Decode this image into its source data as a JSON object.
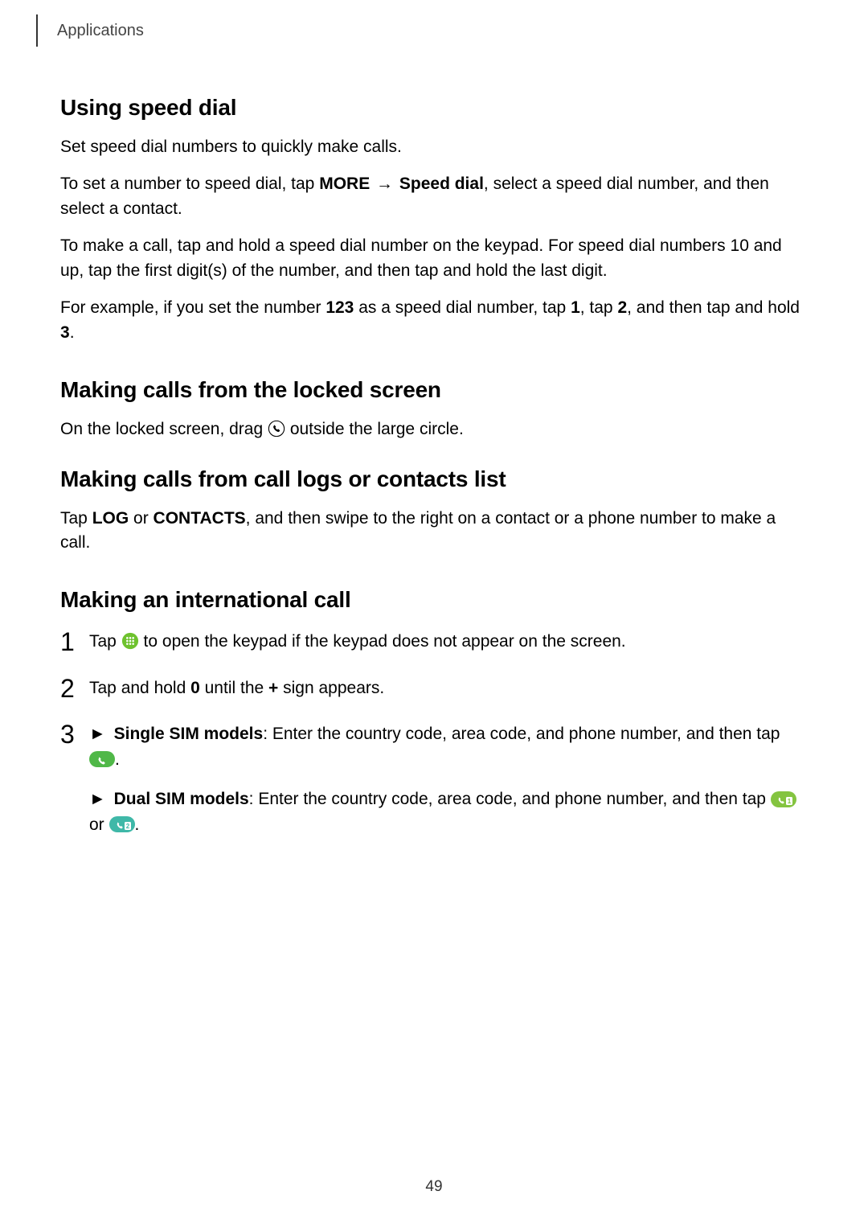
{
  "header": {
    "breadcrumb": "Applications"
  },
  "sections": {
    "speed_dial": {
      "title": "Using speed dial",
      "p1": "Set speed dial numbers to quickly make calls.",
      "p2_a": "To set a number to speed dial, tap ",
      "p2_more": "MORE",
      "p2_arrow": " → ",
      "p2_speed": "Speed dial",
      "p2_b": ", select a speed dial number, and then select a contact.",
      "p3": "To make a call, tap and hold a speed dial number on the keypad. For speed dial numbers 10 and up, tap the first digit(s) of the number, and then tap and hold the last digit.",
      "p4_a": "For example, if you set the number ",
      "p4_123": "123",
      "p4_b": " as a speed dial number, tap ",
      "p4_1": "1",
      "p4_c": ", tap ",
      "p4_2": "2",
      "p4_d": ", and then tap and hold ",
      "p4_3": "3",
      "p4_e": "."
    },
    "locked": {
      "title": "Making calls from the locked screen",
      "p1_a": "On the locked screen, drag ",
      "p1_b": " outside the large circle."
    },
    "logs": {
      "title": "Making calls from call logs or contacts list",
      "p1_a": "Tap ",
      "p1_log": "LOG",
      "p1_b": " or ",
      "p1_contacts": "CONTACTS",
      "p1_c": ", and then swipe to the right on a contact or a phone number to make a call."
    },
    "intl": {
      "title": "Making an international call",
      "step1_a": "Tap ",
      "step1_b": " to open the keypad if the keypad does not appear on the screen.",
      "step2_a": "Tap and hold ",
      "step2_0": "0",
      "step2_b": " until the ",
      "step2_plus": "+",
      "step2_c": " sign appears.",
      "step3_single_label": "Single SIM models",
      "step3_single_text": ": Enter the country code, area code, and phone number, and then tap ",
      "step3_dual_label": "Dual SIM models",
      "step3_dual_text": ": Enter the country code, area code, and phone number, and then tap ",
      "step3_or": " or ",
      "step3_dot": ".",
      "tri": "►"
    }
  },
  "page_number": "49",
  "colors": {
    "keypad_green": "#6ec22e",
    "call_green": "#50b848",
    "sim1_green": "#84c440",
    "sim2_teal": "#3fb8a8"
  }
}
